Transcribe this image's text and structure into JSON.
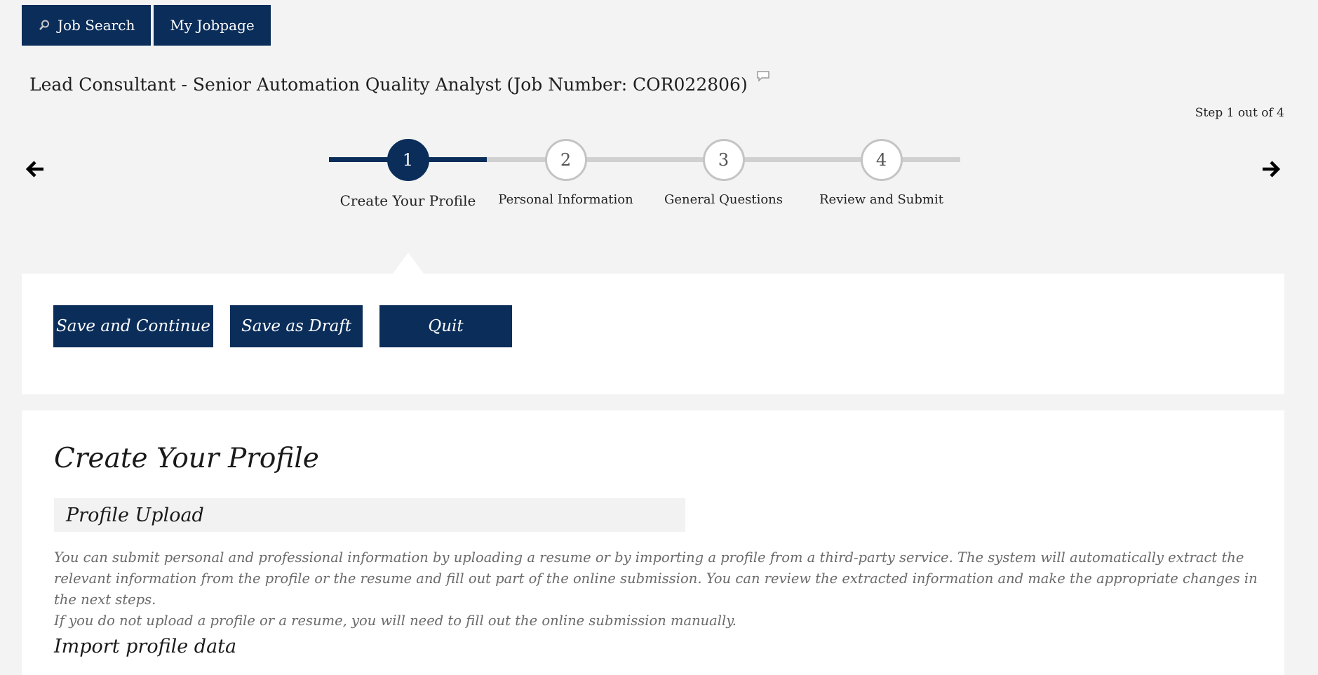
{
  "nav": {
    "job_search": "Job Search",
    "my_jobpage": "My Jobpage"
  },
  "job": {
    "title": "Lead Consultant - Senior Automation Quality Analyst (Job Number: COR022806)"
  },
  "progress": {
    "step_text": "Step 1 out of 4",
    "current_step": 1,
    "total_steps": 4,
    "steps": [
      {
        "number": "1",
        "label": "Create Your Profile"
      },
      {
        "number": "2",
        "label": "Personal Information"
      },
      {
        "number": "3",
        "label": "General Questions"
      },
      {
        "number": "4",
        "label": "Review and Submit"
      }
    ]
  },
  "actions": {
    "save_continue": "Save and Continue",
    "save_draft": "Save as Draft",
    "quit": "Quit"
  },
  "content": {
    "section_title": "Create Your Profile",
    "subhead": "Profile Upload",
    "desc_line1": "You can submit personal and professional information by uploading a resume or by importing a profile from a third-party service. The system will automatically extract the relevant information from the profile or the resume and fill out part of the online submission. You can review the extracted information and make the appropriate changes in the next steps.",
    "desc_line2": "If you do not upload a profile or a resume, you will need to fill out the online submission manually.",
    "import_title": "Import profile data"
  },
  "colors": {
    "primary": "#0b2d5a",
    "background": "#f2f3f2",
    "track_inactive": "#d0d0d0"
  },
  "icons": {
    "job_search": "magnifier-icon",
    "title_comment": "comment-icon",
    "previous": "arrow-left-icon",
    "next": "arrow-right-icon"
  }
}
